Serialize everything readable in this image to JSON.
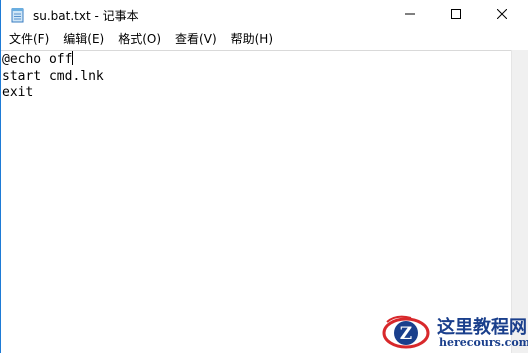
{
  "window": {
    "title": "su.bat.txt - 记事本",
    "controls": {
      "minimize": "—",
      "maximize": "☐",
      "close": "✕"
    }
  },
  "menu": [
    {
      "label": "文件(F)"
    },
    {
      "label": "编辑(E)"
    },
    {
      "label": "格式(O)"
    },
    {
      "label": "查看(V)"
    },
    {
      "label": "帮助(H)"
    }
  ],
  "editor": {
    "lines": [
      "@echo off",
      "start cmd.lnk",
      "exit"
    ]
  },
  "watermark": {
    "title": "这里教程网",
    "url": "herecours.com",
    "logo_letter": "Z"
  },
  "colors": {
    "accent": "#1e7bd6",
    "watermark_blue": "#1a3f8c",
    "watermark_red": "#d8282b"
  }
}
